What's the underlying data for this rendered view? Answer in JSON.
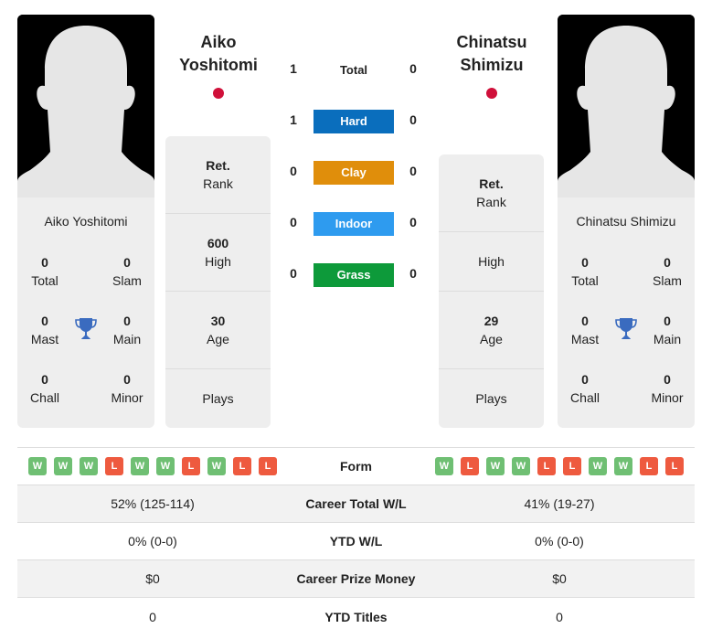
{
  "player_left": {
    "name": "Aiko Yoshitomi",
    "name_line1": "Aiko",
    "name_line2": "Yoshitomi",
    "flag_color": "#d0103a",
    "titles": {
      "total": {
        "value": "0",
        "label": "Total"
      },
      "slam": {
        "value": "0",
        "label": "Slam"
      },
      "mast": {
        "value": "0",
        "label": "Mast"
      },
      "main": {
        "value": "0",
        "label": "Main"
      },
      "chall": {
        "value": "0",
        "label": "Chall"
      },
      "minor": {
        "value": "0",
        "label": "Minor"
      }
    },
    "stats": {
      "rank": {
        "value": "Ret.",
        "label": "Rank"
      },
      "high": {
        "value": "600",
        "label": "High"
      },
      "age": {
        "value": "30",
        "label": "Age"
      },
      "plays": {
        "value": "",
        "label": "Plays"
      }
    }
  },
  "player_right": {
    "name": "Chinatsu Shimizu",
    "name_line1": "Chinatsu",
    "name_line2": "Shimizu",
    "flag_color": "#d0103a",
    "titles": {
      "total": {
        "value": "0",
        "label": "Total"
      },
      "slam": {
        "value": "0",
        "label": "Slam"
      },
      "mast": {
        "value": "0",
        "label": "Mast"
      },
      "main": {
        "value": "0",
        "label": "Main"
      },
      "chall": {
        "value": "0",
        "label": "Chall"
      },
      "minor": {
        "value": "0",
        "label": "Minor"
      }
    },
    "stats": {
      "rank": {
        "value": "Ret.",
        "label": "Rank"
      },
      "high": {
        "value": "",
        "label": "High"
      },
      "age": {
        "value": "29",
        "label": "Age"
      },
      "plays": {
        "value": "",
        "label": "Plays"
      }
    }
  },
  "h2h": {
    "total": {
      "label": "Total",
      "left": "1",
      "right": "0"
    },
    "surfaces": [
      {
        "label": "Hard",
        "left": "1",
        "right": "0",
        "color": "#0a6ebd"
      },
      {
        "label": "Clay",
        "left": "0",
        "right": "0",
        "color": "#e08e0b"
      },
      {
        "label": "Indoor",
        "left": "0",
        "right": "0",
        "color": "#2e9bef"
      },
      {
        "label": "Grass",
        "left": "0",
        "right": "0",
        "color": "#0d9a3a"
      }
    ]
  },
  "comparison": {
    "form_label": "Form",
    "form_left": [
      "W",
      "W",
      "W",
      "L",
      "W",
      "W",
      "L",
      "W",
      "L",
      "L"
    ],
    "form_right": [
      "W",
      "L",
      "W",
      "W",
      "L",
      "L",
      "W",
      "W",
      "L",
      "L"
    ],
    "rows": [
      {
        "label": "Career Total W/L",
        "left": "52% (125-114)",
        "right": "41% (19-27)"
      },
      {
        "label": "YTD W/L",
        "left": "0% (0-0)",
        "right": "0% (0-0)"
      },
      {
        "label": "Career Prize Money",
        "left": "$0",
        "right": "$0"
      },
      {
        "label": "YTD Titles",
        "left": "0",
        "right": "0"
      }
    ]
  },
  "colors": {
    "win": "#6fbf73",
    "loss": "#ee5a3f",
    "trophy": "#3a6bbf"
  }
}
